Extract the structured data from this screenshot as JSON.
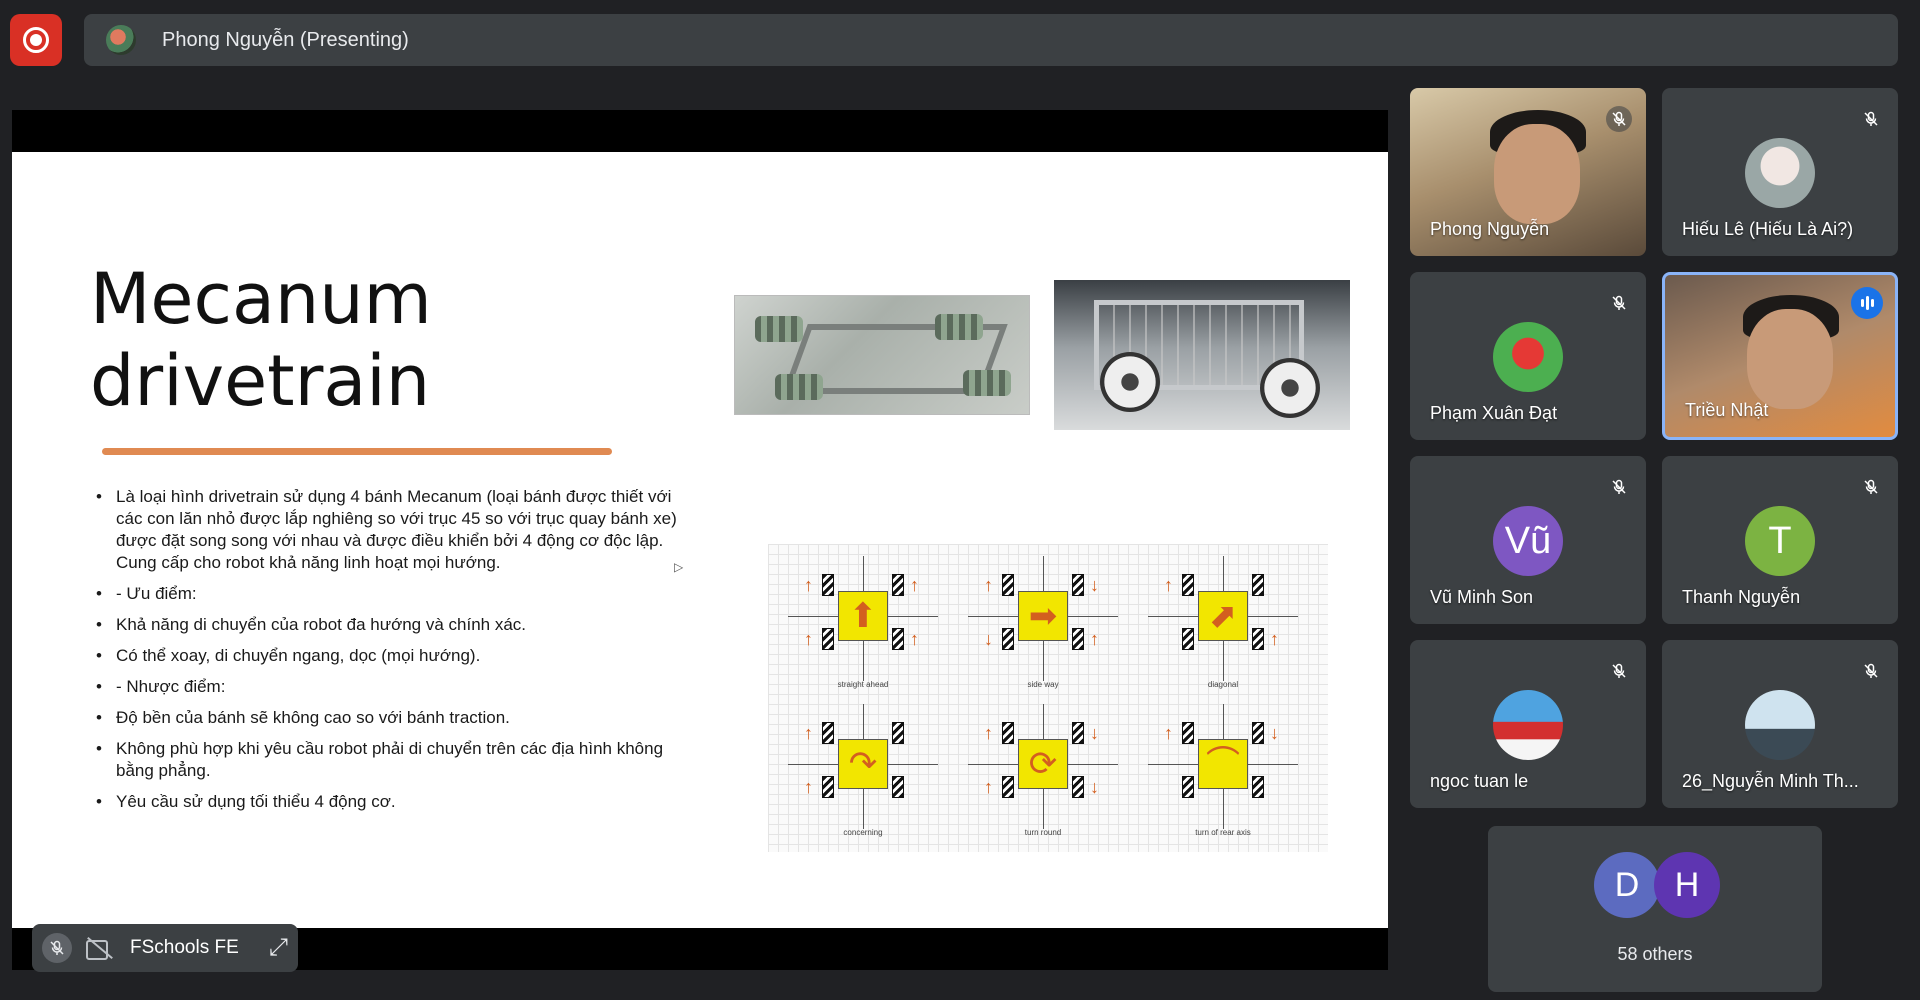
{
  "header": {
    "presenter_label": "Phong Nguyễn (Presenting)"
  },
  "slide": {
    "title_line1": "Mecanum",
    "title_line2": "drivetrain",
    "bullets": [
      "Là loại hình drivetrain sử dụng 4 bánh Mecanum (loại bánh được thiết với các con lăn nhỏ được lắp nghiêng so với trục 45 so với trục quay bánh xe) được đặt song song với nhau và được điều khiển bởi 4 động cơ độc lập. Cung cấp cho robot khả năng linh hoạt mọi hướng.",
      "- Ưu điểm:",
      "Khả năng di chuyển của robot đa hướng và chính xác.",
      " Có thể xoay, di chuyển ngang, dọc (mọi hướng).",
      "- Nhược điểm:",
      "Độ bền của bánh sẽ không cao so với bánh traction.",
      "Không phù hợp khi yêu cầu robot phải di chuyển trên các địa hình không bằng phẳng.",
      "Yêu cầu sử dụng tối thiểu 4 động cơ."
    ],
    "diagram_captions": [
      "straight ahead",
      "side way",
      "diagonal",
      "concerning",
      "turn round",
      "turn of rear axis"
    ]
  },
  "presenter_chip": {
    "name": "FSchools FE"
  },
  "participants": [
    {
      "name": "Phong Nguyễn",
      "muted": true
    },
    {
      "name": "Hiếu Lê (Hiếu Là Ai?)",
      "muted": true
    },
    {
      "name": "Phạm Xuân Đạt",
      "muted": true
    },
    {
      "name": "Triều Nhật",
      "muted": false
    },
    {
      "name": "Vũ Minh Son",
      "initial": "Vũ",
      "muted": true
    },
    {
      "name": "Thanh Nguyễn",
      "initial": "T",
      "muted": true
    },
    {
      "name": "ngoc tuan le",
      "muted": true
    },
    {
      "name": "26_Nguyễn Minh Th...",
      "muted": true
    }
  ],
  "others": {
    "initials": [
      "D",
      "H"
    ],
    "label": "58 others"
  },
  "colors": {
    "background": "#202124",
    "record_red": "#d93025",
    "active_border": "#8ab4f8",
    "vu_avatar": "#7e57c2",
    "t_avatar": "#7cb342",
    "d_avatar": "#5c6bc0",
    "h_avatar": "#5e35b1"
  }
}
